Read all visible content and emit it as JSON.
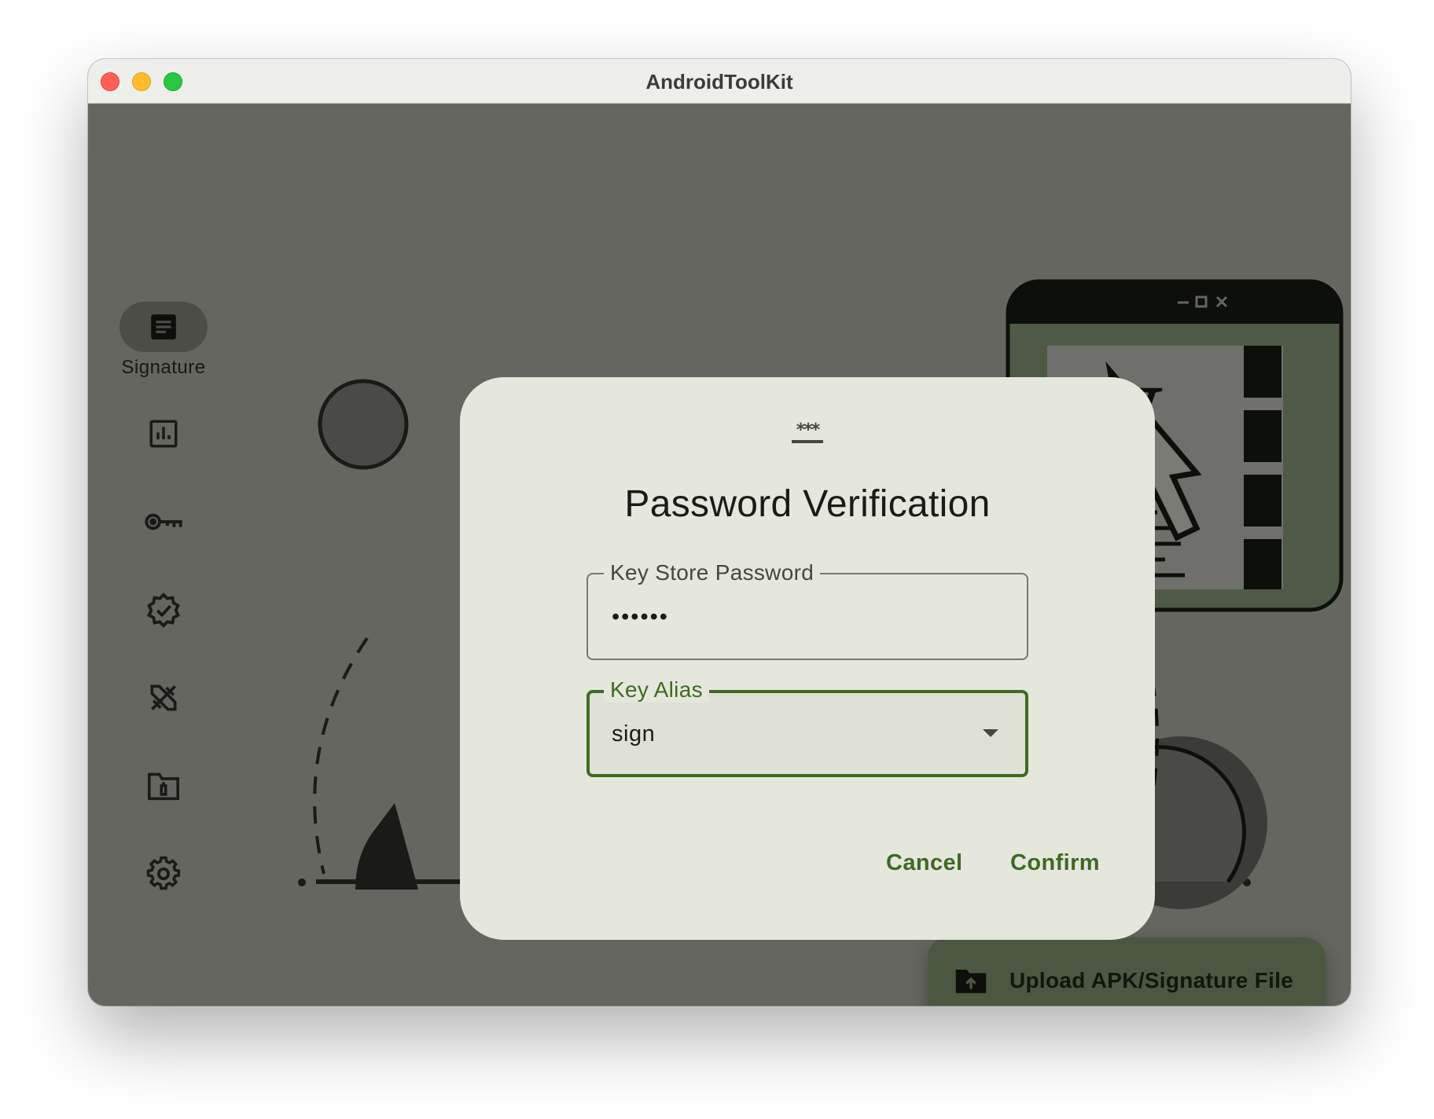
{
  "window": {
    "title": "AndroidToolKit"
  },
  "sidebar": {
    "items": [
      {
        "label": "Signature",
        "icon": "document-icon",
        "active": true
      },
      {
        "label": "",
        "icon": "chart-icon"
      },
      {
        "label": "",
        "icon": "key-icon"
      },
      {
        "label": "",
        "icon": "verified-badge-icon"
      },
      {
        "label": "",
        "icon": "design-tools-icon"
      },
      {
        "label": "",
        "icon": "folder-delete-icon"
      },
      {
        "label": "",
        "icon": "gear-icon"
      }
    ]
  },
  "dialog": {
    "icon": "password-icon",
    "icon_text": "***",
    "title": "Password Verification",
    "keystore_password": {
      "label": "Key Store Password",
      "value": "••••••"
    },
    "key_alias": {
      "label": "Key Alias",
      "value": "sign"
    },
    "cancel_label": "Cancel",
    "confirm_label": "Confirm"
  },
  "fab": {
    "label": "Upload APK/Signature File",
    "icon": "folder-upload-icon"
  },
  "colors": {
    "accent": "#3c6c21",
    "scrim_background": "#656660",
    "dialog_surface": "#e6e7dc",
    "fab_background": "#4b5741"
  }
}
